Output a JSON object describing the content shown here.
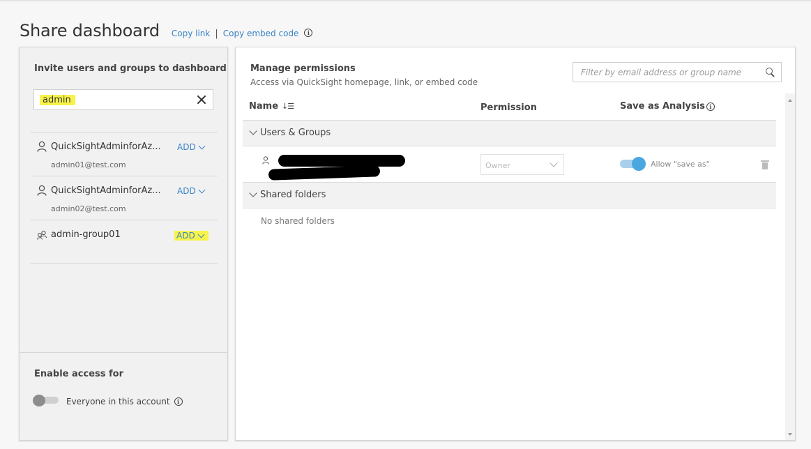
{
  "header": {
    "title": "Share dashboard",
    "copy_link": "Copy link",
    "separator": "|",
    "copy_embed": "Copy embed code"
  },
  "invite": {
    "title": "Invite users and groups to dashboard",
    "search_value": "admin",
    "results": [
      {
        "name": "QuickSightAdminforAz...",
        "email": "admin01@test.com",
        "type": "user",
        "add_label": "ADD"
      },
      {
        "name": "QuickSightAdminforAz...",
        "email": "admin02@test.com",
        "type": "user",
        "add_label": "ADD"
      },
      {
        "name": "admin-group01",
        "email": "",
        "type": "group",
        "add_label": "ADD"
      }
    ]
  },
  "access": {
    "title": "Enable access for",
    "everyone_label": "Everyone in this account",
    "everyone_enabled": false
  },
  "permissions": {
    "title": "Manage permissions",
    "subtitle": "Access via QuickSight homepage, link, or embed code",
    "filter_placeholder": "Filter by email address or group name",
    "columns": {
      "name": "Name",
      "permission": "Permission",
      "save_as": "Save as Analysis"
    },
    "sections": {
      "users_groups": "Users & Groups",
      "shared_folders": "Shared folders"
    },
    "rows": [
      {
        "permission": "Owner",
        "allow_label": "Allow \"save as\"",
        "allow_enabled": true
      }
    ],
    "no_folders": "No shared folders"
  },
  "colors": {
    "link": "#3a83c6",
    "highlight": "#f8f34a",
    "toggle_on": "#4aa7e0"
  }
}
